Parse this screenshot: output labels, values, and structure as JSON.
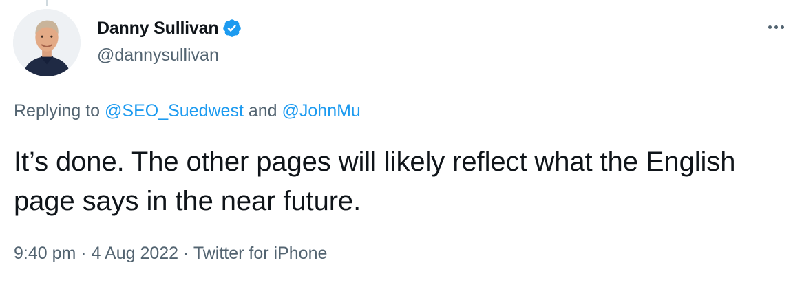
{
  "author": {
    "display_name": "Danny Sullivan",
    "handle": "@dannysullivan",
    "verified_icon": "verified-badge-icon"
  },
  "reply": {
    "prefix": "Replying to ",
    "mention_1": "@SEO_Suedwest",
    "conjunction": " and ",
    "mention_2": "@JohnMu"
  },
  "tweet": {
    "text": "It’s done. The other pages will likely reflect what the English page says in the near future."
  },
  "meta": {
    "time": "9:40 pm",
    "separator_1": " · ",
    "date": "4 Aug 2022",
    "separator_2": " · ",
    "source": "Twitter for iPhone"
  },
  "colors": {
    "accent": "#1d9bf0",
    "secondary_text": "#536471",
    "primary_text": "#0f1419"
  }
}
